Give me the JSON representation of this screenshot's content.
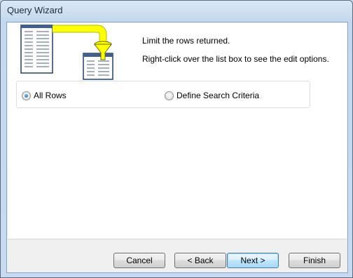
{
  "window": {
    "title": "Query Wizard"
  },
  "content": {
    "line1": "Limit the rows returned.",
    "line2": "Right-click over the list box to see the edit options."
  },
  "options": {
    "all_rows": {
      "label": "All Rows",
      "selected": true
    },
    "define_criteria": {
      "label": "Define Search Criteria",
      "selected": false
    }
  },
  "buttons": {
    "cancel": "Cancel",
    "back": "< Back",
    "next": "Next >",
    "finish": "Finish"
  },
  "colors": {
    "funnel": "#ffff00",
    "pipe": "#ffff00",
    "table_header": "#3f5f8f"
  }
}
